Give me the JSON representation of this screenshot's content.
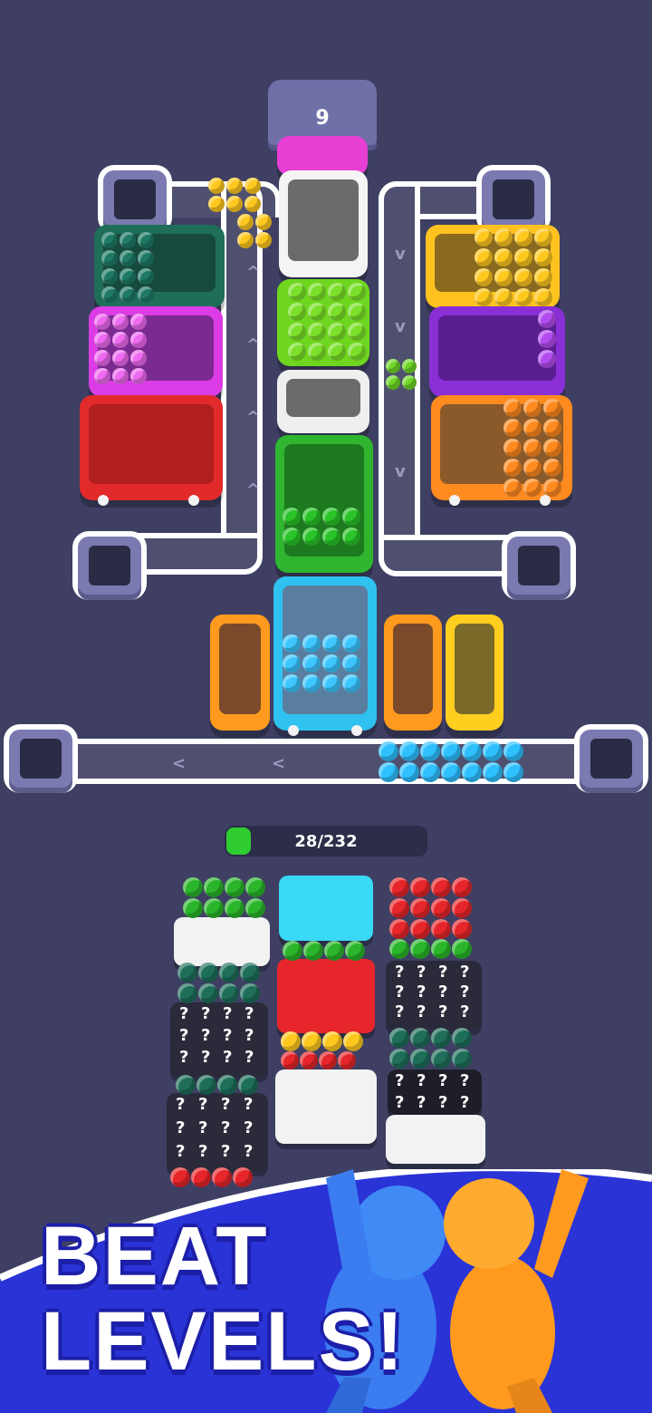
{
  "level_counter": {
    "value": "9"
  },
  "progress": {
    "label": "28/232",
    "fraction": 0.1207
  },
  "banner": {
    "line1": "BEAT",
    "line2": "LEVELS!"
  },
  "colors": {
    "background": "#3e3f63",
    "road": "#4f5070",
    "accent_green": "#2fcc2f",
    "banner_blue": "#2a33d6"
  },
  "icons": {
    "pit": "square-hole",
    "arrow": "chevron-arrow",
    "mystery": "question-mark"
  },
  "mystery_glyph": "?"
}
